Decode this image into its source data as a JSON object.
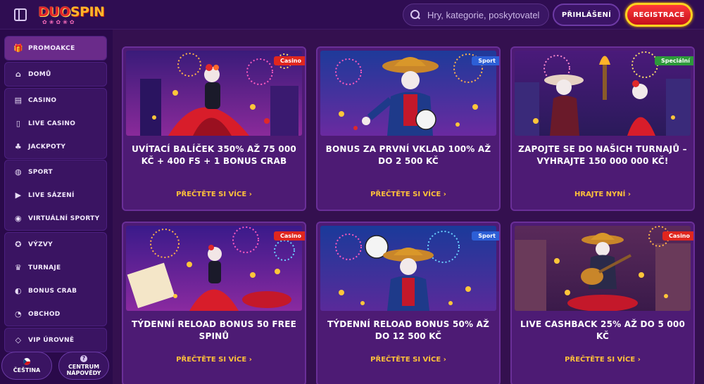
{
  "header": {
    "logo_part1": "DUO",
    "logo_part2": "SPIN",
    "search_placeholder": "Hry, kategorie, poskytovatelé",
    "login_label": "PŘIHLÁŠENÍ",
    "register_label": "REGISTRACE"
  },
  "sidebar": {
    "groups": [
      [
        {
          "label": "PROMOAKCE",
          "icon": "gift-icon",
          "active": true
        }
      ],
      [
        {
          "label": "DOMŮ",
          "icon": "home-icon"
        }
      ],
      [
        {
          "label": "CASINO",
          "icon": "slot-machine-icon"
        },
        {
          "label": "LIVE CASINO",
          "icon": "cards-icon"
        },
        {
          "label": "JACKPOTY",
          "icon": "clover-icon"
        }
      ],
      [
        {
          "label": "SPORT",
          "icon": "ball-icon"
        },
        {
          "label": "LIVE SÁZENÍ",
          "icon": "play-icon"
        },
        {
          "label": "VIRTUÁLNÍ SPORTY",
          "icon": "vr-icon"
        }
      ],
      [
        {
          "label": "VÝZVY",
          "icon": "medal-icon"
        },
        {
          "label": "TURNAJE",
          "icon": "trophy-icon"
        },
        {
          "label": "BONUS CRAB",
          "icon": "crab-icon"
        },
        {
          "label": "OBCHOD",
          "icon": "shop-icon"
        }
      ],
      [
        {
          "label": "VIP ÚROVNĚ",
          "icon": "diamond-icon"
        }
      ]
    ],
    "language_label": "ČEŠTINA",
    "help_label_line1": "CENTRUM",
    "help_label_line2": "NÁPOVĚDY"
  },
  "promotions": [
    {
      "badge": "Casino",
      "badge_type": "casino",
      "title": "UVÍTACÍ BALÍČEK 350% AŽ 75 000 KČ + 400 FS + 1 BONUS CRAB",
      "link": "PŘEČTĚTE SI VÍCE",
      "theme": "dancer-red"
    },
    {
      "badge": "Sport",
      "badge_type": "sport",
      "title": "BONUS ZA PRVNÍ VKLAD 100% AŽ DO 2 500 KČ",
      "link": "PŘEČTĚTE SI VÍCE",
      "theme": "footballer"
    },
    {
      "badge": "Speciální",
      "badge_type": "special",
      "title": "ZAPOJTE SE DO NAŠICH TURNAJŮ – VYHRAJTE 150 000 000 KČ!",
      "link": "HRAJTE NYNÍ",
      "theme": "torch-couple"
    },
    {
      "badge": "Casino",
      "badge_type": "casino",
      "title": "TÝDENNÍ RELOAD BONUS 50 FREE SPINŮ",
      "link": "PŘEČTĚTE SI VÍCE",
      "theme": "dancer-coins"
    },
    {
      "badge": "Sport",
      "badge_type": "sport",
      "title": "TÝDENNÍ RELOAD BONUS 50% AŽ DO 12 500 KČ",
      "link": "PŘEČTĚTE SI VÍCE",
      "theme": "footballer-ball"
    },
    {
      "badge": "Casino",
      "badge_type": "casino",
      "title": "LIVE CASHBACK 25% AŽ DO 5 000 KČ",
      "link": "PŘEČTĚTE SI VÍCE",
      "theme": "guitarist"
    }
  ],
  "colors": {
    "accent": "#ffc13a",
    "casino_badge": "#e0261e",
    "sport_badge": "#2d5fd6",
    "special_badge": "#2d9a3a",
    "register": "#d8151f"
  }
}
